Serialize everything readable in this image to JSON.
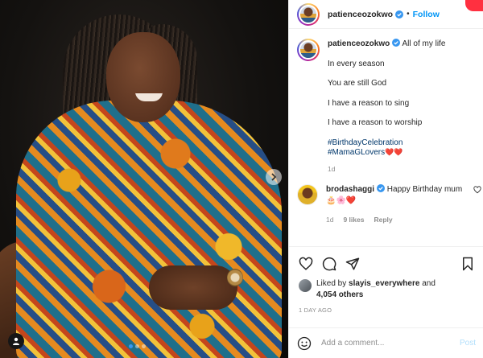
{
  "post": {
    "username": "patienceozokwo",
    "separator": "•",
    "follow_label": "Follow",
    "caption": {
      "first_line": "All of my life",
      "lines": [
        "In every season",
        "You are still God",
        "I have a reason to sing",
        "I have a reason to worship"
      ],
      "hashtags": [
        "#BirthdayCelebration",
        "#MamaGLovers"
      ],
      "hashtag_suffix": "❤️❤️",
      "time": "1d"
    },
    "comments": [
      {
        "username": "brodashaggi",
        "text": "Happy Birthday mum 🎂🌸❤️",
        "time": "1d",
        "likes": "9 likes",
        "reply_label": "Reply"
      }
    ],
    "liked_by": {
      "prefix": "Liked by",
      "user": "slayis_everywhere",
      "conjunction": "and",
      "others": "4,054 others"
    },
    "time_ago": "1 DAY AGO",
    "add_comment": {
      "placeholder": "Add a comment...",
      "post_label": "Post"
    }
  },
  "carousel": {
    "slides": 3,
    "active_index": 0
  },
  "colors": {
    "link": "#0095f6",
    "hashtag": "#00376b",
    "heart": "#ed4956",
    "muted": "#8e8e8e"
  }
}
